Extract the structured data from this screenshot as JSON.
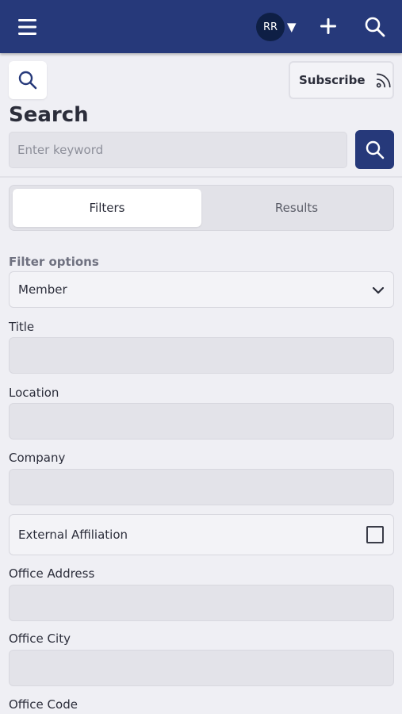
{
  "topbar": {
    "avatar_initials": "RR",
    "caret": "▼",
    "menu_icon": "hamburger-icon",
    "add_icon": "plus-icon",
    "search_icon": "search-icon",
    "color": "#26397a"
  },
  "header": {
    "search_icon": "search-icon",
    "subscribe_label": "Subscribe",
    "subscribe_icon": "rss-feed-icon",
    "title": "Search",
    "keyword_placeholder": "Enter keyword",
    "keyword_value": "",
    "submit_icon": "search-icon"
  },
  "tabs": [
    {
      "label": "Filters",
      "active": true
    },
    {
      "label": "Results",
      "active": false
    }
  ],
  "form": {
    "filter_options_label": "Filter options",
    "filter_options_value": "Member",
    "title_label": "Title",
    "title_value": "",
    "location_label": "Location",
    "location_value": "",
    "company_label": "Company",
    "company_value": "",
    "external_affiliation_label": "External Affiliation",
    "external_affiliation_checked": false,
    "office_address_label": "Office Address",
    "office_address_value": "",
    "office_city_label": "Office City",
    "office_city_value": "",
    "office_code_label": "Office Code"
  }
}
